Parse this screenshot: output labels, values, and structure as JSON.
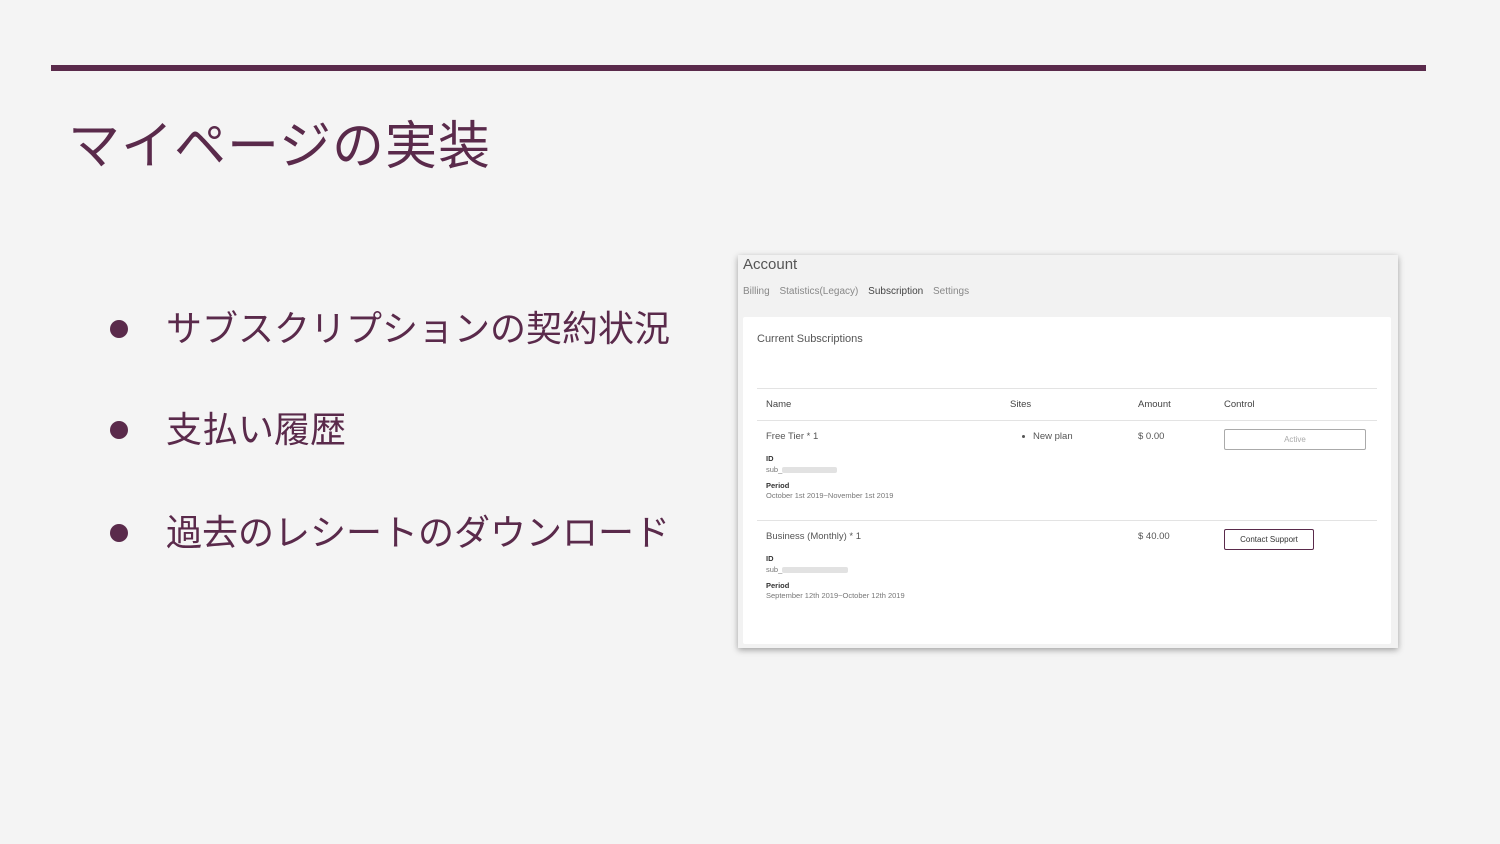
{
  "slide": {
    "title": "マイページの実装",
    "bullets": [
      "サブスクリプションの契約状況",
      "支払い履歴",
      "過去のレシートのダウンロード"
    ]
  },
  "account": {
    "title": "Account",
    "tabs": [
      "Billing",
      "Statistics(Legacy)",
      "Subscription",
      "Settings"
    ],
    "active_tab": "Subscription",
    "card_title": "Current Subscriptions",
    "columns": [
      "Name",
      "Sites",
      "Amount",
      "Control"
    ],
    "rows": [
      {
        "name": "Free Tier * 1",
        "id_label": "ID",
        "id_value": "sub_",
        "period_label": "Period",
        "period": "October 1st 2019~November 1st 2019",
        "sites": "New plan",
        "amount": "$ 0.00",
        "control": "Active"
      },
      {
        "name": "Business (Monthly) * 1",
        "id_label": "ID",
        "id_value": "sub_",
        "period_label": "Period",
        "period": "September 12th 2019~October 12th 2019",
        "sites": "",
        "amount": "$ 40.00",
        "control": "Contact Support"
      }
    ]
  },
  "colors": {
    "accent": "#5a2a4b",
    "background": "#f4f4f4"
  }
}
